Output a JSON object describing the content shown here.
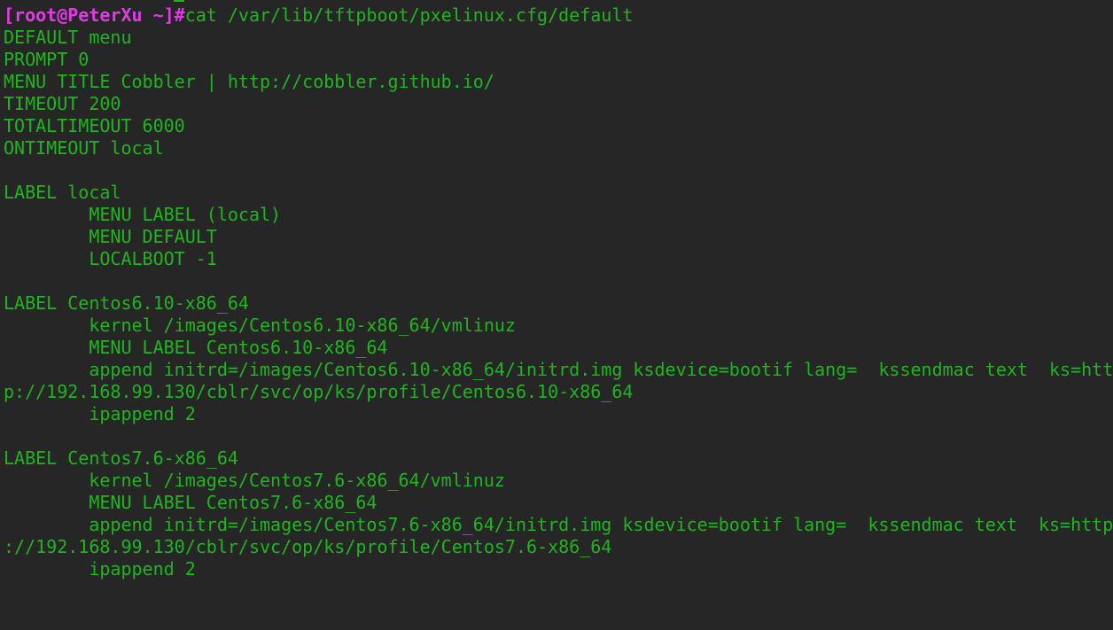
{
  "terminal": {
    "prompt": "[root@PeterXu ~]#",
    "command": "cat /var/lib/tftpboot/pxelinux.cfg/default",
    "colors": {
      "background": "#262626",
      "text": "#1fb51f",
      "prompt": "#e23be6"
    },
    "output": [
      "DEFAULT menu",
      "PROMPT 0",
      "MENU TITLE Cobbler | http://cobbler.github.io/",
      "TIMEOUT 200",
      "TOTALTIMEOUT 6000",
      "ONTIMEOUT local",
      "",
      "LABEL local",
      "        MENU LABEL (local)",
      "        MENU DEFAULT",
      "        LOCALBOOT -1",
      "",
      "LABEL Centos6.10-x86_64",
      "        kernel /images/Centos6.10-x86_64/vmlinuz",
      "        MENU LABEL Centos6.10-x86_64",
      "        append initrd=/images/Centos6.10-x86_64/initrd.img ksdevice=bootif lang=  kssendmac text  ks=htt",
      "p://192.168.99.130/cblr/svc/op/ks/profile/Centos6.10-x86_64",
      "        ipappend 2",
      "",
      "LABEL Centos7.6-x86_64",
      "        kernel /images/Centos7.6-x86_64/vmlinuz",
      "        MENU LABEL Centos7.6-x86_64",
      "        append initrd=/images/Centos7.6-x86_64/initrd.img ksdevice=bootif lang=  kssendmac text  ks=http",
      "://192.168.99.130/cblr/svc/op/ks/profile/Centos7.6-x86_64",
      "        ipappend 2"
    ]
  }
}
